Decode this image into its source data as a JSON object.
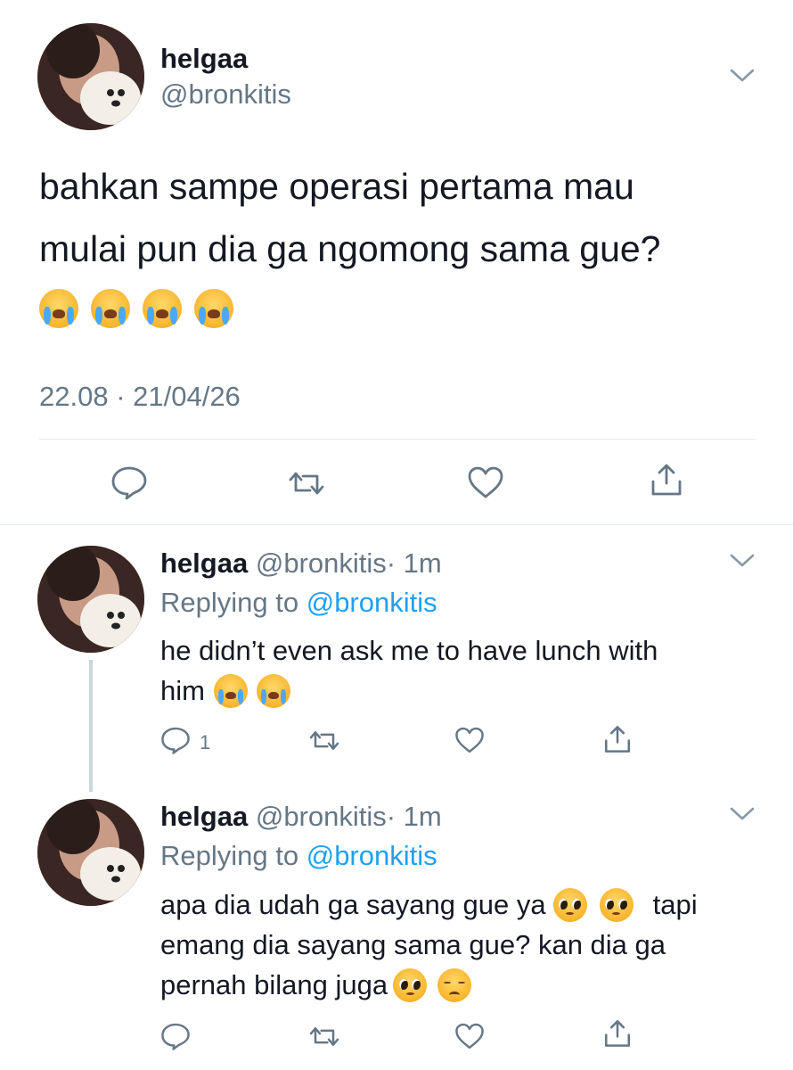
{
  "main_tweet": {
    "display_name": "helgaa",
    "handle": "@bronkitis",
    "text_line1": "bahkan sampe operasi pertama mau",
    "text_line2": "mulai pun dia ga ngomong sama gue?",
    "timestamp": "22.08 · 21/04/26",
    "emojis": [
      "loudly-crying-face",
      "loudly-crying-face",
      "loudly-crying-face",
      "loudly-crying-face"
    ]
  },
  "replies": [
    {
      "display_name": "helgaa",
      "handle": "@bronkitis",
      "time": "· 1m",
      "replying_prefix": "Replying to",
      "replying_to": "@bronkitis",
      "line1": "he didn’t even ask me to have lunch with",
      "line2": "him",
      "reply_count": "1"
    },
    {
      "display_name": "helgaa",
      "handle": "@bronkitis",
      "time": "· 1m",
      "replying_prefix": "Replying to",
      "replying_to": "@bronkitis",
      "line1": "apa dia udah ga sayang gue ya",
      "line1_tail": "tapi",
      "line2": "emang dia sayang sama gue? kan dia ga",
      "line3": "pernah bilang juga",
      "reply_count": ""
    }
  ],
  "colors": {
    "text": "#141823",
    "muted": "#657786",
    "link": "#1da1f2",
    "divider": "#e1e8ed"
  }
}
